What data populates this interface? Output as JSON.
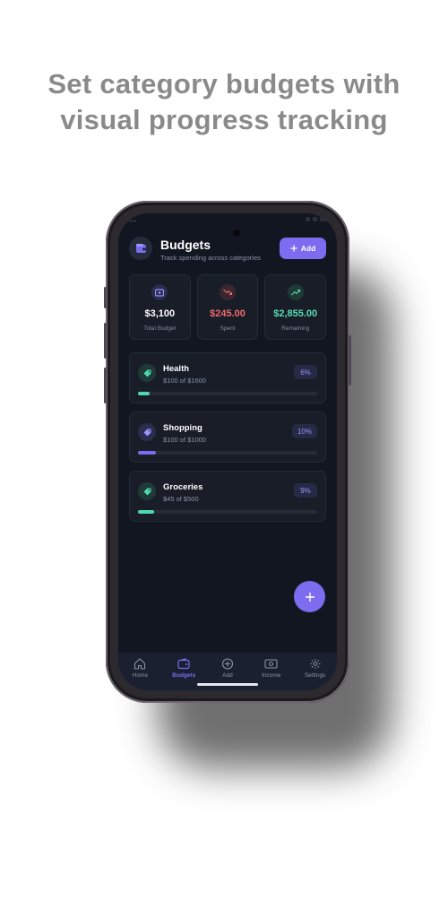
{
  "headline": {
    "line1": "Set category budgets with",
    "line2": "visual progress tracking"
  },
  "header": {
    "title": "Budgets",
    "subtitle": "Track spending across categories",
    "add_label": "Add",
    "icon": "wallet-icon"
  },
  "stats": [
    {
      "value": "$3,100",
      "label": "Total Budget",
      "icon": "wallet-icon",
      "color": "#ffffff"
    },
    {
      "value": "$245.00",
      "label": "Spent",
      "icon": "trend-down-icon",
      "color": "#ef6a6a"
    },
    {
      "value": "$2,855.00",
      "label": "Remaining",
      "icon": "trend-up-icon",
      "color": "#59dcb0"
    }
  ],
  "categories": [
    {
      "name": "Health",
      "amount": "$100 of $1600",
      "percent_label": "6%",
      "progress": 0.0625,
      "color": "#4fd8b0",
      "icon": "tag-icon"
    },
    {
      "name": "Shopping",
      "amount": "$100 of $1000",
      "percent_label": "10%",
      "progress": 0.1,
      "color": "#7c6cf0",
      "icon": "tag-icon"
    },
    {
      "name": "Groceries",
      "amount": "$45 of $500",
      "percent_label": "9%",
      "progress": 0.09,
      "color": "#4fd8b0",
      "icon": "tag-icon"
    }
  ],
  "nav": {
    "items": [
      {
        "label": "Home",
        "icon": "home-icon"
      },
      {
        "label": "Budgets",
        "icon": "wallet-icon",
        "active": true
      },
      {
        "label": "Add",
        "icon": "plus-circle-icon"
      },
      {
        "label": "Income",
        "icon": "cash-icon"
      },
      {
        "label": "Settings",
        "icon": "gear-icon"
      }
    ]
  },
  "colors": {
    "accent": "#7c6cf0",
    "teal": "#4fd8b0",
    "red": "#ef6a6a",
    "background": "#121620"
  }
}
